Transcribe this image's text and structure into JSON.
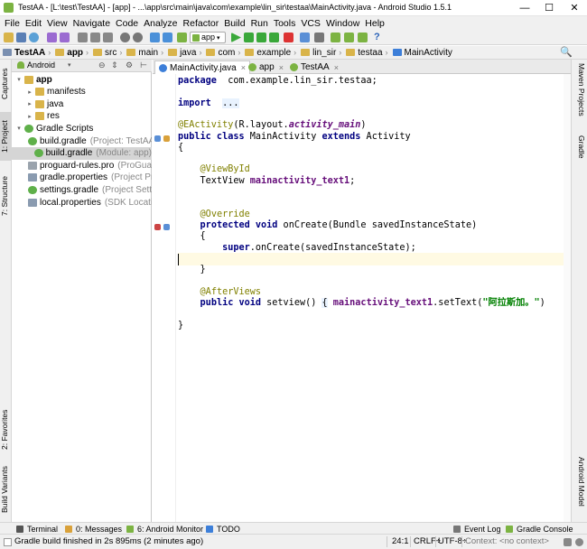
{
  "window": {
    "title": "TestAA - [L:\\test\\TestAA] - [app] - ...\\app\\src\\main\\java\\com\\example\\lin_sir\\testaa\\MainActivity.java - Android Studio 1.5.1",
    "minimize": "—",
    "maximize": "☐",
    "close": "✕"
  },
  "menu": {
    "items": [
      "File",
      "Edit",
      "View",
      "Navigate",
      "Code",
      "Analyze",
      "Refactor",
      "Build",
      "Run",
      "Tools",
      "VCS",
      "Window",
      "Help"
    ]
  },
  "toolbar": {
    "run_config": "app",
    "help": "?",
    "search": "🔍"
  },
  "navbar": {
    "crumbs": [
      "TestAA",
      "app",
      "src",
      "main",
      "java",
      "com",
      "example",
      "lin_sir",
      "testaa",
      "MainActivity"
    ],
    "sep": "›"
  },
  "left_tabs": {
    "captures": "Captures",
    "project": "1: Project",
    "structure": "7: Structure",
    "favorites": "2: Favorites",
    "build_variants": "Build Variants"
  },
  "right_tabs": {
    "maven": "Maven Projects",
    "gradle": "Gradle",
    "android_model": "Android Model"
  },
  "project": {
    "view_selector": "Android",
    "tree": [
      {
        "label": "app",
        "secondary": "",
        "indent": 0,
        "arrow": "▾",
        "icon": "folder",
        "bold": true
      },
      {
        "label": "manifests",
        "secondary": "",
        "indent": 1,
        "arrow": "▸",
        "icon": "folder",
        "bold": false
      },
      {
        "label": "java",
        "secondary": "",
        "indent": 1,
        "arrow": "▸",
        "icon": "folder",
        "bold": false
      },
      {
        "label": "res",
        "secondary": "",
        "indent": 1,
        "arrow": "▸",
        "icon": "folder",
        "bold": false
      },
      {
        "label": "Gradle Scripts",
        "secondary": "",
        "indent": 0,
        "arrow": "▾",
        "icon": "gradle",
        "bold": false
      },
      {
        "label": "build.gradle",
        "secondary": "(Project: TestAA)",
        "indent": 1,
        "arrow": "",
        "icon": "gradle",
        "bold": false
      },
      {
        "label": "build.gradle",
        "secondary": "(Module: app)",
        "indent": 1,
        "arrow": "",
        "icon": "gradle",
        "bold": false,
        "selected": true
      },
      {
        "label": "proguard-rules.pro",
        "secondary": "(ProGuard",
        "indent": 1,
        "arrow": "",
        "icon": "file",
        "bold": false
      },
      {
        "label": "gradle.properties",
        "secondary": "(Project Prop",
        "indent": 1,
        "arrow": "",
        "icon": "props",
        "bold": false
      },
      {
        "label": "settings.gradle",
        "secondary": "(Project Settin",
        "indent": 1,
        "arrow": "",
        "icon": "gradle",
        "bold": false
      },
      {
        "label": "local.properties",
        "secondary": "(SDK Location",
        "indent": 1,
        "arrow": "",
        "icon": "props",
        "bold": false
      }
    ]
  },
  "tabs": [
    {
      "label": "MainActivity.java",
      "close": "×",
      "active": true,
      "color": "#3d7fd9"
    },
    {
      "label": "app",
      "close": "×",
      "active": false,
      "color": "#7cb342"
    },
    {
      "label": "TestAA",
      "close": "×",
      "active": false,
      "color": "#7cb342"
    }
  ],
  "code": {
    "lines": [
      [
        [
          "kw",
          "package"
        ],
        [
          "",
          "  com.example.lin_sir.testaa;"
        ]
      ],
      [],
      [
        [
          "kw",
          "import"
        ],
        [
          "",
          "  "
        ],
        [
          "fold",
          "..."
        ]
      ],
      [],
      [
        [
          "an",
          "@EActivity"
        ],
        [
          "",
          "(R.layout."
        ],
        [
          "it",
          "activity_main"
        ],
        [
          "",
          ")"
        ]
      ],
      [
        [
          "kw",
          "public class"
        ],
        [
          "",
          " MainActivity "
        ],
        [
          "kw",
          "extends"
        ],
        [
          "",
          " Activity"
        ]
      ],
      [
        [
          "",
          "{"
        ]
      ],
      [],
      [
        [
          "",
          "    "
        ],
        [
          "an",
          "@ViewById"
        ]
      ],
      [
        [
          "",
          "    TextView "
        ],
        [
          "fl",
          "mainactivity_text1"
        ],
        [
          "",
          ";"
        ]
      ],
      [],
      [],
      [
        [
          "",
          "    "
        ],
        [
          "an",
          "@Override"
        ]
      ],
      [
        [
          "",
          "    "
        ],
        [
          "kw",
          "protected void"
        ],
        [
          "",
          " onCreate(Bundle savedInstanceState)"
        ]
      ],
      [
        [
          "",
          "    {"
        ]
      ],
      [
        [
          "",
          "        "
        ],
        [
          "kw",
          "super"
        ],
        [
          "",
          ".onCreate(savedInstanceState);"
        ]
      ],
      [],
      [
        [
          "",
          "    }"
        ]
      ],
      [],
      [
        [
          "",
          "    "
        ],
        [
          "an",
          "@AfterViews"
        ]
      ],
      [
        [
          "",
          "    "
        ],
        [
          "kw",
          "public void"
        ],
        [
          "",
          " setview() "
        ],
        [
          "fold",
          "{"
        ],
        [
          "",
          " "
        ],
        [
          "fl",
          "mainactivity_text1"
        ],
        [
          "",
          ".setText("
        ],
        [
          "st",
          "\"阿拉斯加。\""
        ],
        [
          "",
          ")"
        ]
      ],
      [],
      [
        [
          "",
          "}"
        ]
      ]
    ],
    "current_line": 16
  },
  "bottom_tabs": [
    {
      "label": "Terminal",
      "color": "#555555"
    },
    {
      "label": "0: Messages",
      "color": "#d9a13a"
    },
    {
      "label": "6: Android Monitor",
      "color": "#7cb342"
    },
    {
      "label": "TODO",
      "color": "#3d7fd9"
    },
    {
      "label": "Event Log",
      "color": "#777777"
    },
    {
      "label": "Gradle Console",
      "color": "#7cb342"
    }
  ],
  "status": {
    "message": "Gradle build finished in 2s 895ms (2 minutes ago)",
    "position": "24:1",
    "line_sep": "CRLF÷",
    "encoding": "UTF-8÷",
    "context": "Context: <no context>"
  },
  "colors": {
    "accent": "#3d7fd9",
    "android_green": "#7cb342",
    "keyword": "#000080",
    "annotation": "#808000",
    "field": "#660e7a",
    "string": "#008000"
  }
}
